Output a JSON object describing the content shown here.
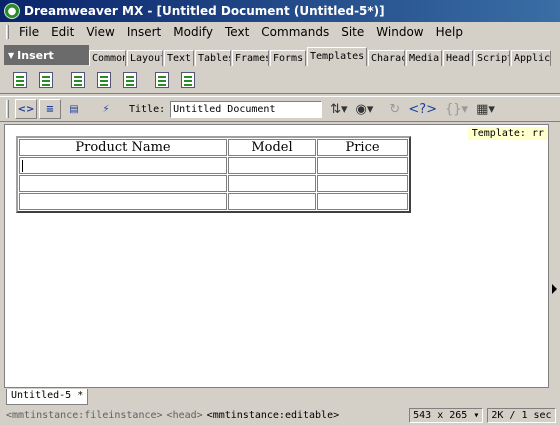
{
  "window": {
    "title": "Dreamweaver MX - [Untitled Document (Untitled-5*)]"
  },
  "menubar": {
    "items": [
      "File",
      "Edit",
      "View",
      "Insert",
      "Modify",
      "Text",
      "Commands",
      "Site",
      "Window",
      "Help"
    ]
  },
  "insert_panel": {
    "label": "Insert",
    "tabs": [
      "Common",
      "Layout",
      "Text",
      "Tables",
      "Frames",
      "Forms",
      "Templates",
      "Characters",
      "Media",
      "Head",
      "Script",
      "Application"
    ],
    "active_tab": "Templates",
    "icons": [
      "make-template-icon",
      "make-nested-template-icon",
      "editable-region-icon",
      "optional-region-icon",
      "repeating-region-icon",
      "editable-optional-region-icon",
      "repeating-table-icon"
    ]
  },
  "doc_toolbar": {
    "title_label": "Title:",
    "title_value": "Untitled Document"
  },
  "document": {
    "template_badge": "Template: rr",
    "table": {
      "headers": [
        "Product Name",
        "Model",
        "Price"
      ],
      "rows": [
        [
          "",
          "",
          ""
        ],
        [
          "",
          "",
          ""
        ],
        [
          "",
          "",
          ""
        ]
      ]
    },
    "tab_label": "Untitled-5 *"
  },
  "statusbar": {
    "tags": [
      "<mmtinstance:fileinstance>",
      "<head>",
      "<mmtinstance:editable>"
    ],
    "dimensions": "543 x 265",
    "download": "2K / 1 sec"
  }
}
